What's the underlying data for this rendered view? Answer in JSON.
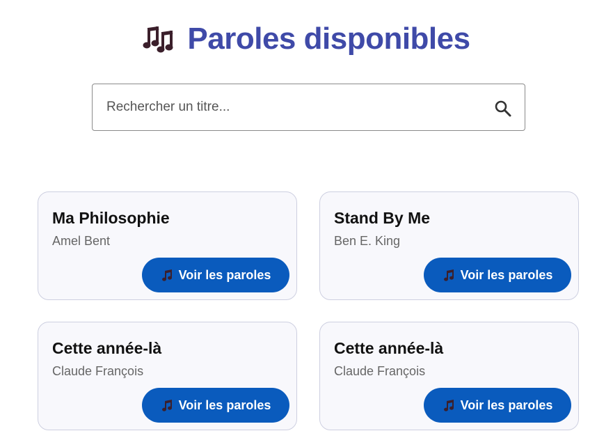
{
  "header": {
    "title": "Paroles disponibles",
    "icon": "music-notes-icon",
    "title_color": "#3f4aa8"
  },
  "search": {
    "placeholder": "Rechercher un titre...",
    "value": "",
    "icon": "search-icon"
  },
  "songs": [
    {
      "title": "Ma Philosophie",
      "artist": "Amel Bent",
      "button_label": "Voir les paroles"
    },
    {
      "title": "Stand By Me",
      "artist": "Ben E. King",
      "button_label": "Voir les paroles"
    },
    {
      "title": "Cette année-là",
      "artist": "Claude François",
      "button_label": "Voir les paroles"
    },
    {
      "title": "Cette année-là",
      "artist": "Claude François",
      "button_label": "Voir les paroles"
    }
  ],
  "colors": {
    "button_bg": "#0a5bbd",
    "card_bg": "#f8f8fc",
    "card_border": "#cdcfe0",
    "icon_dark": "#3b1f2b"
  }
}
